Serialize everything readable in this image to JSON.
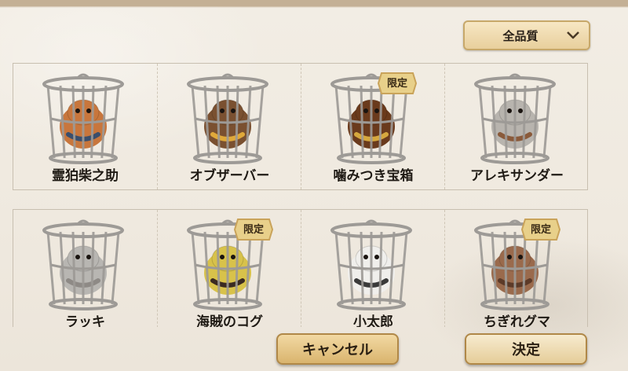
{
  "filter": {
    "label": "全品質"
  },
  "pets": [
    {
      "name": "霊狛柴之助",
      "limited": false,
      "body": "#c8763c",
      "accent": "#3a4e6c"
    },
    {
      "name": "オブザーバー",
      "limited": false,
      "body": "#7a5030",
      "accent": "#e0a93a"
    },
    {
      "name": "噛みつき宝箱",
      "limited": true,
      "body": "#6a3a1c",
      "accent": "#d6a83e"
    },
    {
      "name": "アレキサンダー",
      "limited": false,
      "body": "#b8b4ae",
      "accent": "#8a5a3a"
    },
    {
      "name": "ラッキ",
      "limited": false,
      "body": "#b8b6b2",
      "accent": "#8e8a86"
    },
    {
      "name": "海賊のコグ",
      "limited": true,
      "body": "#d8c24a",
      "accent": "#3a2a22"
    },
    {
      "name": "小太郎",
      "limited": false,
      "body": "#f0efec",
      "accent": "#3a3a3a"
    },
    {
      "name": "ちぎれグマ",
      "limited": true,
      "body": "#9a6a4c",
      "accent": "#5c3a28"
    }
  ],
  "badge": {
    "label": "限定"
  },
  "buttons": {
    "cancel": "キャンセル",
    "confirm": "決定"
  },
  "colors": {
    "cage": "#9d9a96",
    "gold": "#c9a35a"
  }
}
